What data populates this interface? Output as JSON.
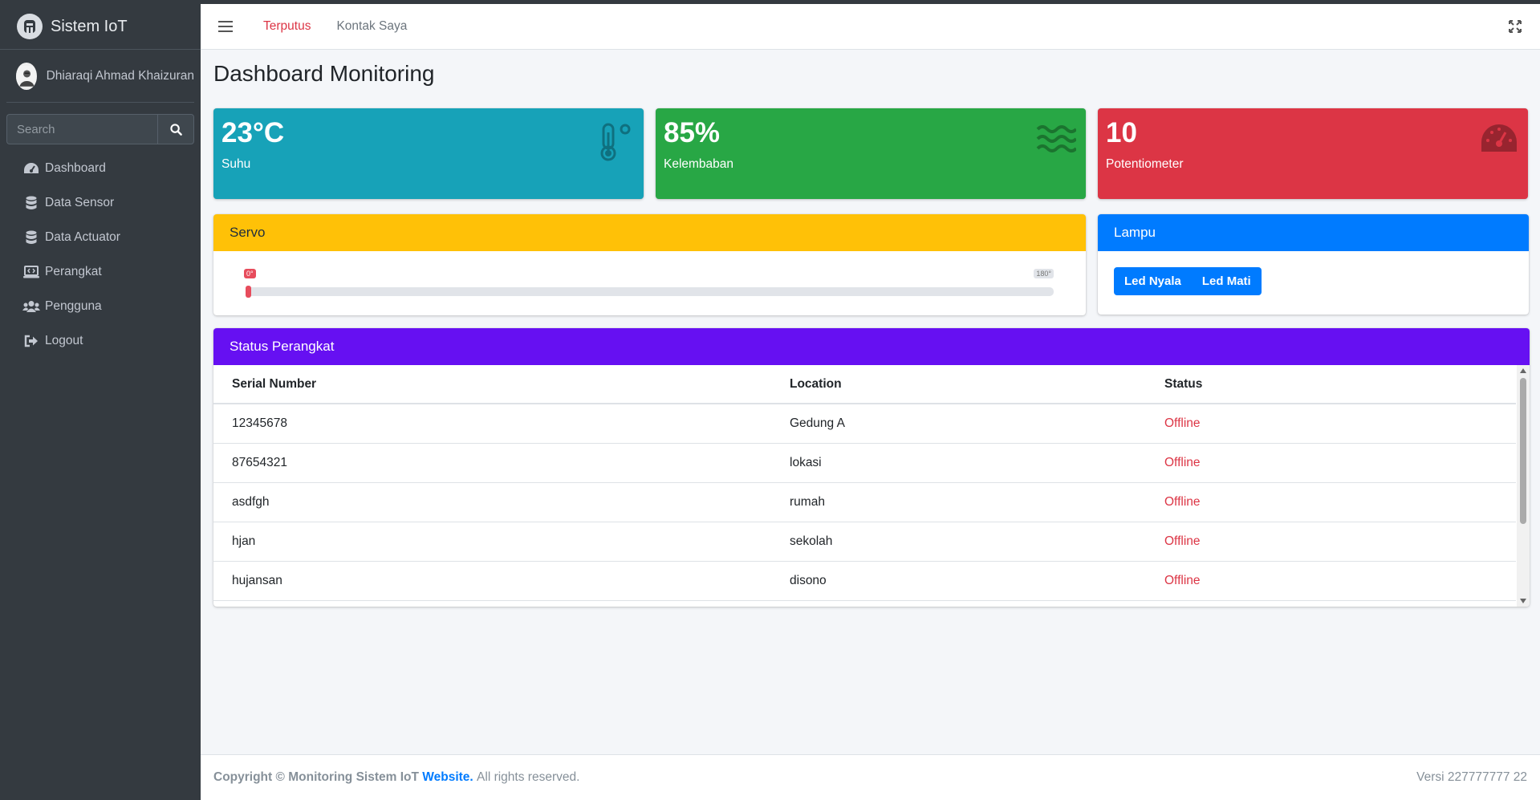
{
  "brand": {
    "name": "Sistem IoT"
  },
  "user": {
    "name": "Dhiaraqi Ahmad Khaizuran"
  },
  "search": {
    "placeholder": "Search"
  },
  "sidebar": {
    "items": [
      {
        "label": "Dashboard",
        "icon": "tachometer-icon"
      },
      {
        "label": "Data Sensor",
        "icon": "database-icon"
      },
      {
        "label": "Data Actuator",
        "icon": "database-icon"
      },
      {
        "label": "Perangkat",
        "icon": "laptop-code-icon"
      },
      {
        "label": "Pengguna",
        "icon": "users-icon"
      },
      {
        "label": "Logout",
        "icon": "sign-out-icon"
      }
    ]
  },
  "header": {
    "status_link": "Terputus",
    "contact_link": "Kontak Saya"
  },
  "page": {
    "title": "Dashboard Monitoring"
  },
  "stats": {
    "suhu": {
      "value": "23°C",
      "label": "Suhu",
      "color": "#17a2b8",
      "icon": "thermometer-icon"
    },
    "kelembaban": {
      "value": "85%",
      "label": "Kelembaban",
      "color": "#28a745",
      "icon": "water-icon"
    },
    "potentiometer": {
      "value": "10",
      "label": "Potentiometer",
      "color": "#dc3545",
      "icon": "gauge-icon"
    }
  },
  "servo": {
    "title": "Servo",
    "min_label": "0°",
    "max_label": "180°",
    "value": 0,
    "max": 180
  },
  "lampu": {
    "title": "Lampu",
    "on_label": "Led Nyala",
    "off_label": "Led Mati"
  },
  "status": {
    "title": "Status Perangkat",
    "columns": [
      "Serial Number",
      "Location",
      "Status"
    ],
    "rows": [
      [
        "12345678",
        "Gedung A",
        "Offline"
      ],
      [
        "87654321",
        "lokasi",
        "Offline"
      ],
      [
        "asdfgh",
        "rumah",
        "Offline"
      ],
      [
        "hjan",
        "sekolah",
        "Offline"
      ],
      [
        "hujansan",
        "disono",
        "Offline"
      ]
    ]
  },
  "footer": {
    "copyright": "Copyright © Monitoring Sistem IoT",
    "link": "Website.",
    "rights": "All rights reserved.",
    "version": "Versi 227777777 22"
  },
  "colors": {
    "sidebar_bg": "#343a40",
    "servo_header": "#ffc107",
    "lampu_header": "#007bff",
    "status_header": "#6610f2",
    "offline": "#dc3545"
  }
}
